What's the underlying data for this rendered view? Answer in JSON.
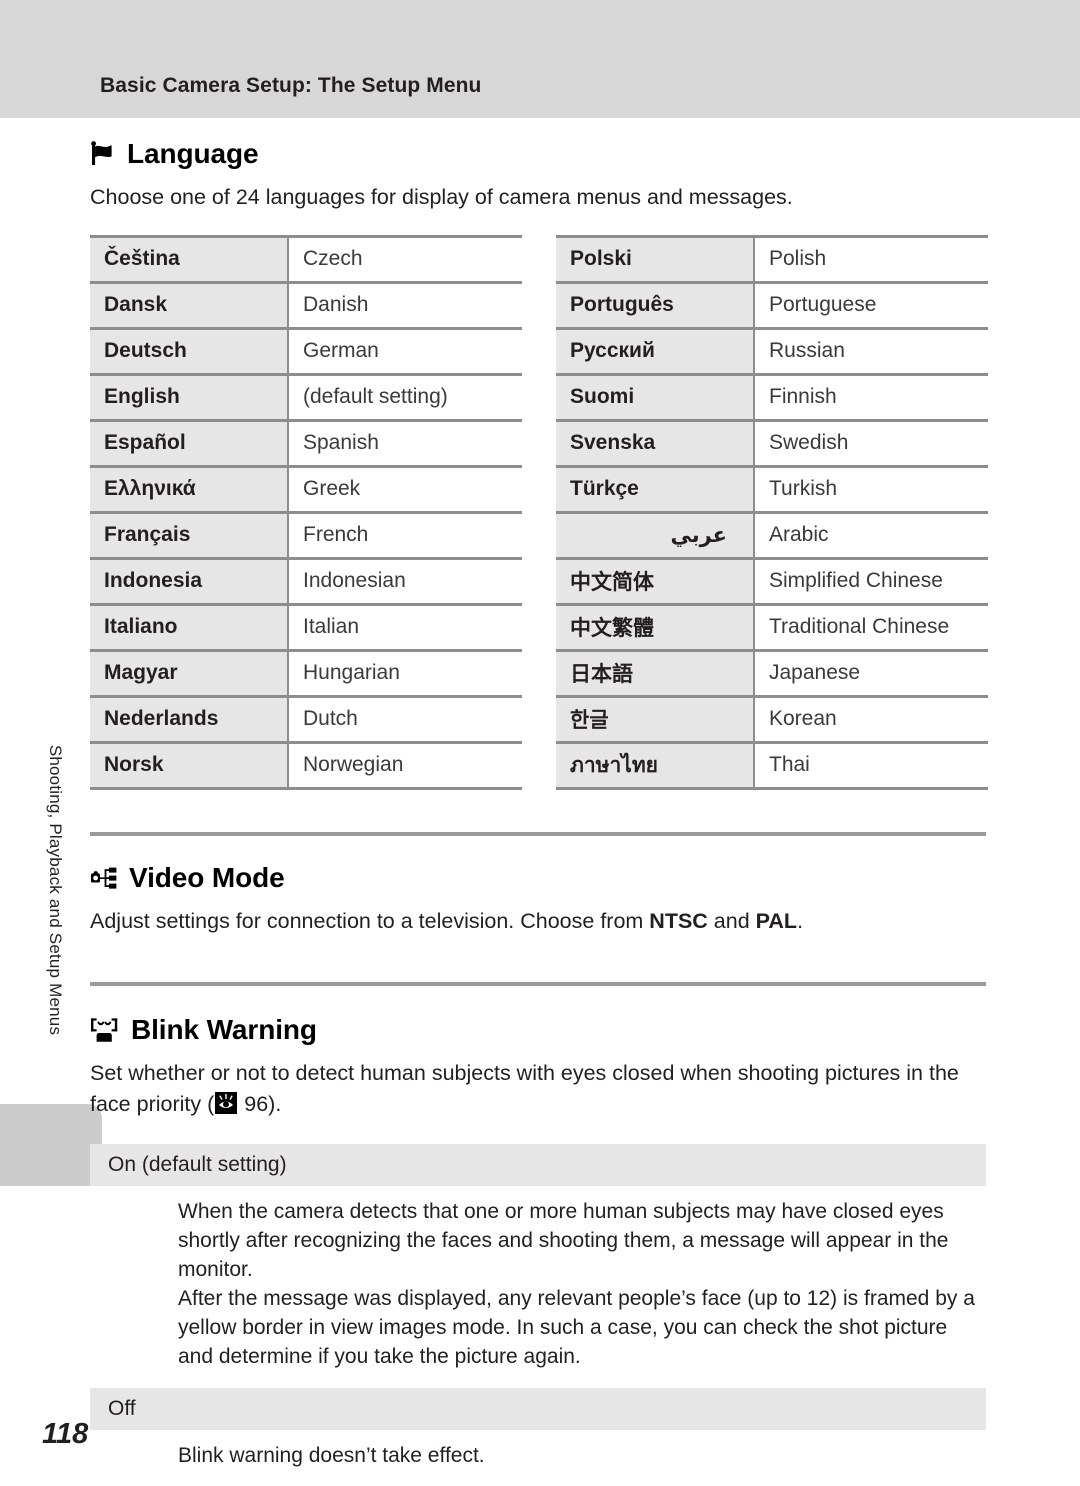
{
  "header": {
    "title": "Basic Camera Setup: The Setup Menu"
  },
  "side_tab": {
    "label": "Shooting, Playback and Setup Menus"
  },
  "page_number": "118",
  "sections": {
    "language": {
      "icon": "flag-icon",
      "heading": "Language",
      "intro": "Choose one of 24 languages for display of camera menus and messages.",
      "table_left": [
        {
          "native": "Čeština",
          "english": "Czech"
        },
        {
          "native": "Dansk",
          "english": "Danish"
        },
        {
          "native": "Deutsch",
          "english": "German"
        },
        {
          "native": "English",
          "english": "(default setting)"
        },
        {
          "native": "Español",
          "english": "Spanish"
        },
        {
          "native": "Ελληνικά",
          "english": "Greek"
        },
        {
          "native": "Français",
          "english": "French"
        },
        {
          "native": "Indonesia",
          "english": "Indonesian"
        },
        {
          "native": "Italiano",
          "english": "Italian"
        },
        {
          "native": "Magyar",
          "english": "Hungarian"
        },
        {
          "native": "Nederlands",
          "english": "Dutch"
        },
        {
          "native": "Norsk",
          "english": "Norwegian"
        }
      ],
      "table_right": [
        {
          "native": "Polski",
          "english": "Polish"
        },
        {
          "native": "Português",
          "english": "Portuguese"
        },
        {
          "native": "Русский",
          "english": "Russian"
        },
        {
          "native": "Suomi",
          "english": "Finnish"
        },
        {
          "native": "Svenska",
          "english": "Swedish"
        },
        {
          "native": "Türkçe",
          "english": "Turkish"
        },
        {
          "native": "عربي",
          "english": "Arabic",
          "rtl": true
        },
        {
          "native": "中文简体",
          "english": "Simplified Chinese"
        },
        {
          "native": "中文繁體",
          "english": "Traditional Chinese"
        },
        {
          "native": "日本語",
          "english": "Japanese"
        },
        {
          "native": "한글",
          "english": "Korean"
        },
        {
          "native": "ภาษาไทย",
          "english": "Thai"
        }
      ]
    },
    "video_mode": {
      "icon": "video-out-icon",
      "heading": "Video Mode",
      "body_part1": "Adjust settings for connection to a television. Choose from ",
      "body_bold1": "NTSC",
      "body_part2": " and ",
      "body_bold2": "PAL",
      "body_part3": "."
    },
    "blink_warning": {
      "icon": "blink-face-icon",
      "heading": "Blink Warning",
      "body_part1": "Set whether or not to detect human subjects with eyes closed when shooting pictures in the face priority (",
      "reference_icon": "face-priority-eye-icon",
      "reference_page": "96",
      "body_part2": ").",
      "options": [
        {
          "label": "On (default setting)",
          "paragraphs": [
            "When the camera detects that one or more human subjects may have closed eyes shortly after recognizing the faces and shooting them, a message will appear in the monitor.",
            "After the message was displayed, any relevant people’s face (up to 12) is framed by a yellow border in view images mode. In such a case, you can check the shot picture and determine if you take the picture again."
          ]
        },
        {
          "label": "Off",
          "paragraphs": [
            "Blink warning doesn’t take effect."
          ]
        }
      ]
    }
  },
  "colors": {
    "header_band": "#d7d7d7",
    "table_label_bg": "#e6e6e6",
    "rule": "#9a9a9a",
    "text": "#231f20"
  }
}
